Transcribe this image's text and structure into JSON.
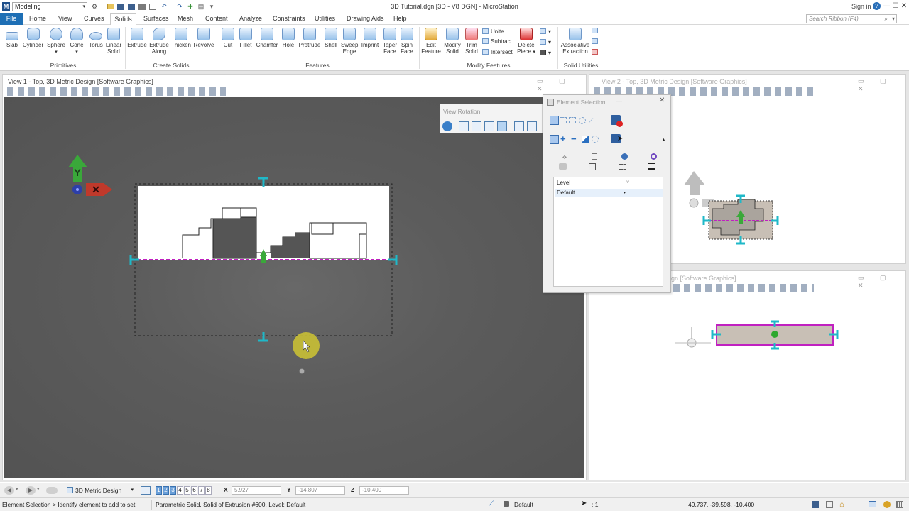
{
  "titlebar": {
    "workflow": "Modeling",
    "app_title": "3D Tutorial.dgn [3D - V8 DGN] - MicroStation",
    "sign_in": "Sign in",
    "help_icon": "question-icon",
    "minimize": "—",
    "maximize": "☐",
    "close": "✕"
  },
  "tabs": [
    "File",
    "Home",
    "View",
    "Curves",
    "Solids",
    "Surfaces",
    "Mesh",
    "Content",
    "Analyze",
    "Constraints",
    "Utilities",
    "Drawing Aids",
    "Help"
  ],
  "active_tab": "Solids",
  "search": {
    "placeholder": "Search Ribbon (F4)"
  },
  "ribbon": {
    "primitives": {
      "label": "Primitives",
      "buttons": [
        "Slab",
        "Cylinder",
        "Sphere",
        "Cone",
        "Torus",
        "Linear Solid"
      ]
    },
    "create_solids": {
      "label": "Create Solids",
      "buttons": [
        "Extrude",
        "Extrude Along",
        "Thicken",
        "Revolve"
      ]
    },
    "features": {
      "label": "Features",
      "buttons": [
        "Cut",
        "Fillet",
        "Chamfer",
        "Hole",
        "Protrude",
        "Shell",
        "Sweep Edge",
        "Imprint",
        "Taper Face",
        "Spin Face"
      ]
    },
    "modify_features": {
      "label": "Modify Features",
      "buttons": [
        "Edit Feature",
        "Modify Solid",
        "Trim Solid"
      ],
      "small": [
        "Unite",
        "Subtract",
        "Intersect"
      ],
      "delete_piece": "Delete Piece"
    },
    "solid_utilities": {
      "label": "Solid Utilities",
      "buttons": [
        "Associative Extraction"
      ]
    }
  },
  "views": {
    "view1": {
      "title": "View 1 - Top, 3D Metric Design [Software Graphics]"
    },
    "view2": {
      "title": "View 2 - Top, 3D Metric Design [Software Graphics]"
    },
    "view3": {
      "title": "gn [Software Graphics]"
    }
  },
  "element_selection": {
    "title": "Element Selection",
    "level_header": "Level",
    "levels": [
      "Default"
    ],
    "level_marker": "•"
  },
  "view_rotation": {
    "title": "View Rotation"
  },
  "bottom_toolbar": {
    "model": "3D Metric Design",
    "view_numbers": [
      "1",
      "2",
      "3",
      "4",
      "5",
      "6",
      "7",
      "8"
    ],
    "x_label": "X",
    "x_value": "5.927",
    "y_label": "Y",
    "y_value": "-14.807",
    "z_label": "Z",
    "z_value": "-10.400"
  },
  "statusbar": {
    "prompt": "Element Selection > Identify element to add to set",
    "message": "Parametric Solid, Solid of Extrusion #600, Level: Default",
    "active_level": "Default",
    "count": ": 1",
    "coords": "49.737, -39.598, -10.400"
  },
  "colors": {
    "file_tab": "#1e6fb5",
    "canvas_bg": "#5c5c5c",
    "handle_cyan": "#1fb8c8",
    "selection_magenta": "#c020c0",
    "y_axis_green": "#3aa83a",
    "x_axis_red": "#c0392b",
    "cursor_highlight": "#d8d23a"
  }
}
